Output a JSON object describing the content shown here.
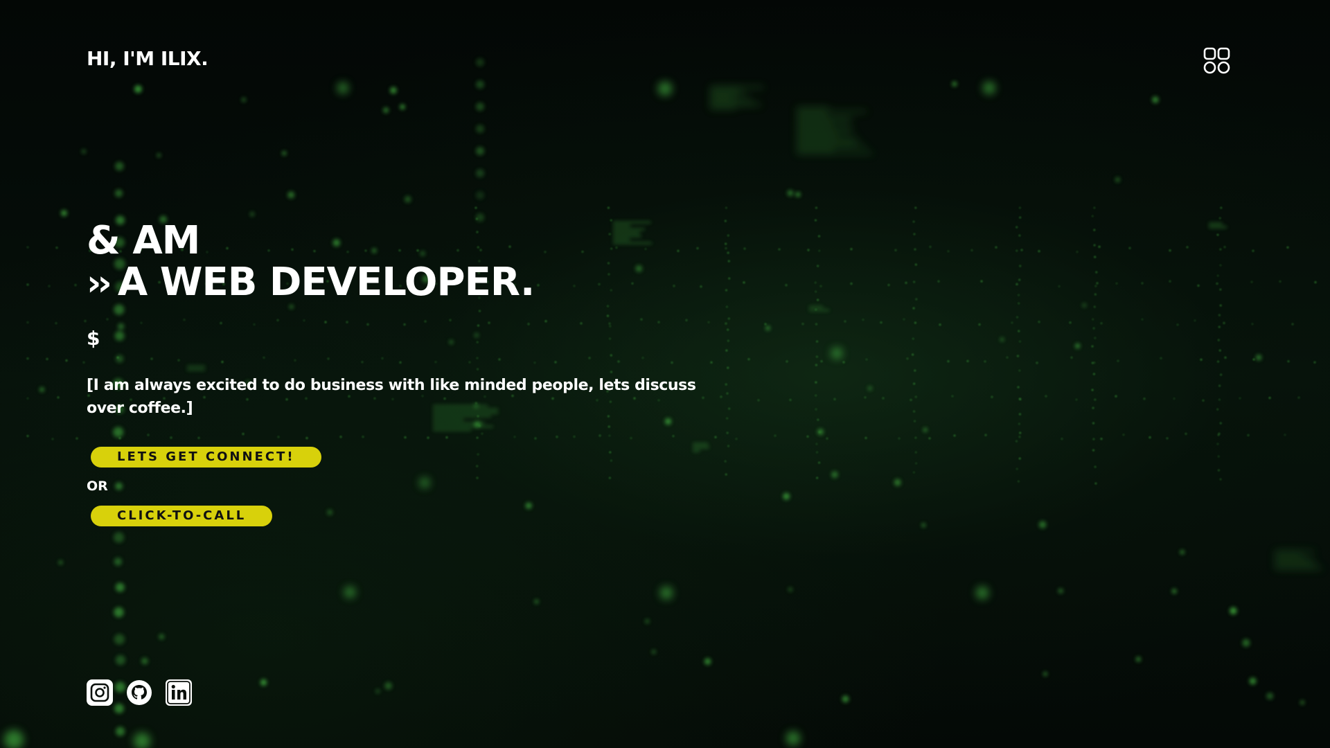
{
  "header": {
    "brand": "HI, I'M ILIX.",
    "menu_icon": "grid-menu-icon"
  },
  "hero": {
    "line1": "& AM",
    "line2_prefix": "››",
    "line2": "A WEB DEVELOPER."
  },
  "prompt": "$",
  "tagline": "[I am always excited to do business with like minded people, lets discuss over coffee.]",
  "cta": {
    "connect_label": "LETS GET CONNECT!",
    "or_label": "OR",
    "call_label": "CLICK-TO-CALL"
  },
  "socials": [
    {
      "name": "instagram-icon"
    },
    {
      "name": "github-icon"
    },
    {
      "name": "linkedin-icon"
    }
  ],
  "colors": {
    "accent": "#d8d10b",
    "background": "#040a06",
    "glow": "#4fd14a",
    "text": "#ffffff"
  }
}
